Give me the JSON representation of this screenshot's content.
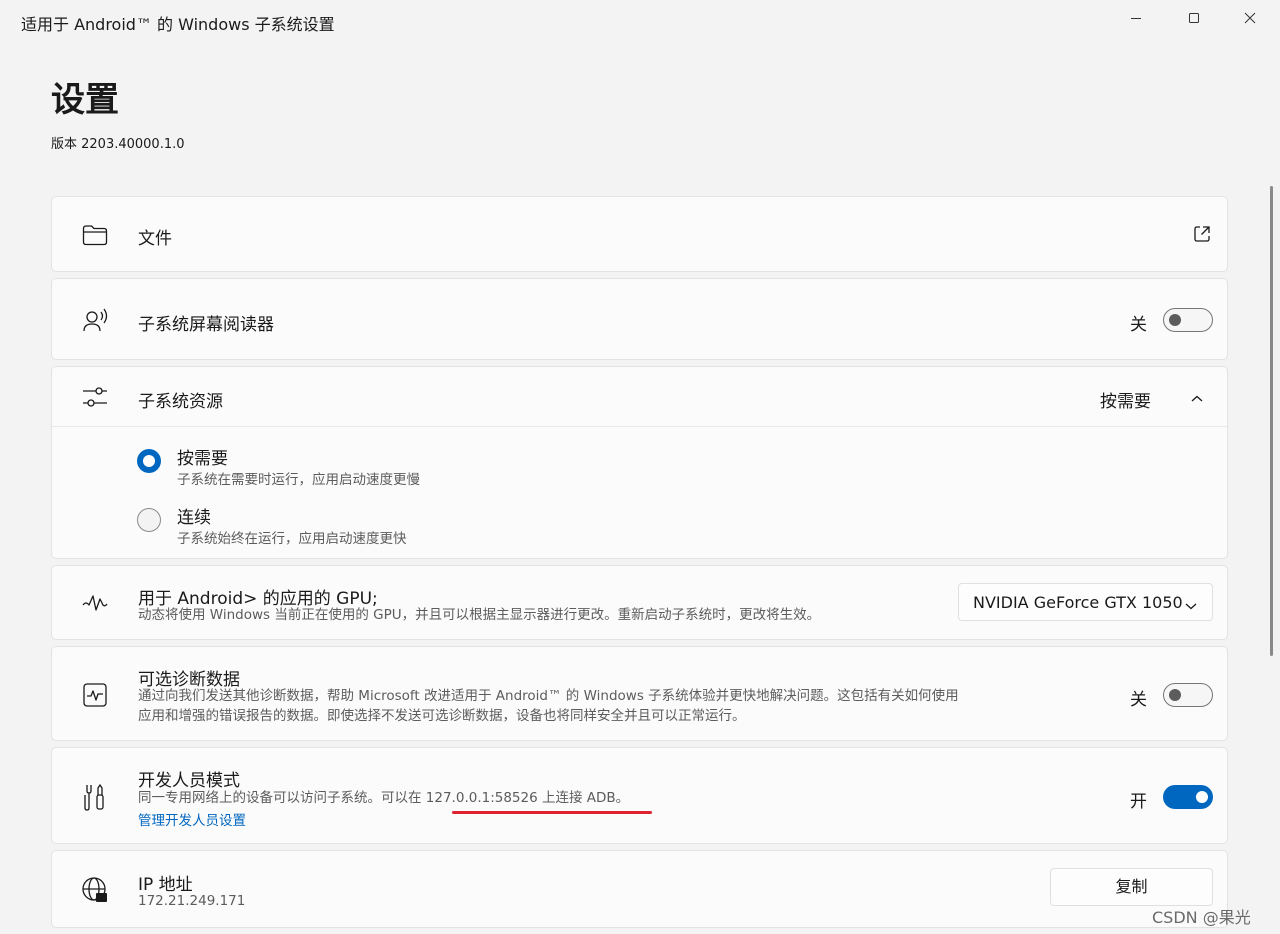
{
  "window": {
    "title": "适用于 Android™ 的 Windows 子系统设置"
  },
  "header": {
    "title": "设置",
    "version": "版本 2203.40000.1.0"
  },
  "files": {
    "label": "文件"
  },
  "screen_reader": {
    "label": "子系统屏幕阅读器",
    "state": "关",
    "enabled": false
  },
  "resources": {
    "label": "子系统资源",
    "selected": "按需要",
    "options": [
      {
        "label": "按需要",
        "desc": "子系统在需要时运行，应用启动速度更慢",
        "checked": true
      },
      {
        "label": "连续",
        "desc": "子系统始终在运行，应用启动速度更快",
        "checked": false
      }
    ]
  },
  "gpu": {
    "label": "用于 Android> 的应用的 GPU;",
    "desc": "动态将使用 Windows 当前正在使用的 GPU，并且可以根据主显示器进行更改。重新启动子系统时，更改将生效。",
    "selected": "NVIDIA GeForce GTX 1050"
  },
  "diagnostics": {
    "label": "可选诊断数据",
    "desc1": "通过向我们发送其他诊断数据，帮助 Microsoft 改进适用于 Android™ 的 Windows 子系统体验并更快地解决问题。这包括有关如何使用",
    "desc2": "应用和增强的错误报告的数据。即使选择不发送可选诊断数据，设备也将同样安全并且可以正常运行。",
    "state": "关",
    "enabled": false
  },
  "developer": {
    "label": "开发人员模式",
    "desc": "同一专用网络上的设备可以访问子系统。可以在 127.0.0.1:58526 上连接 ADB。",
    "link": "管理开发人员设置",
    "state": "开",
    "enabled": true
  },
  "ip": {
    "label": "IP 地址",
    "value": "172.21.249.171",
    "copy_label": "复制"
  },
  "watermark": "CSDN @果光",
  "colors": {
    "accent": "#0067c0",
    "highlight": "#e0242f"
  }
}
